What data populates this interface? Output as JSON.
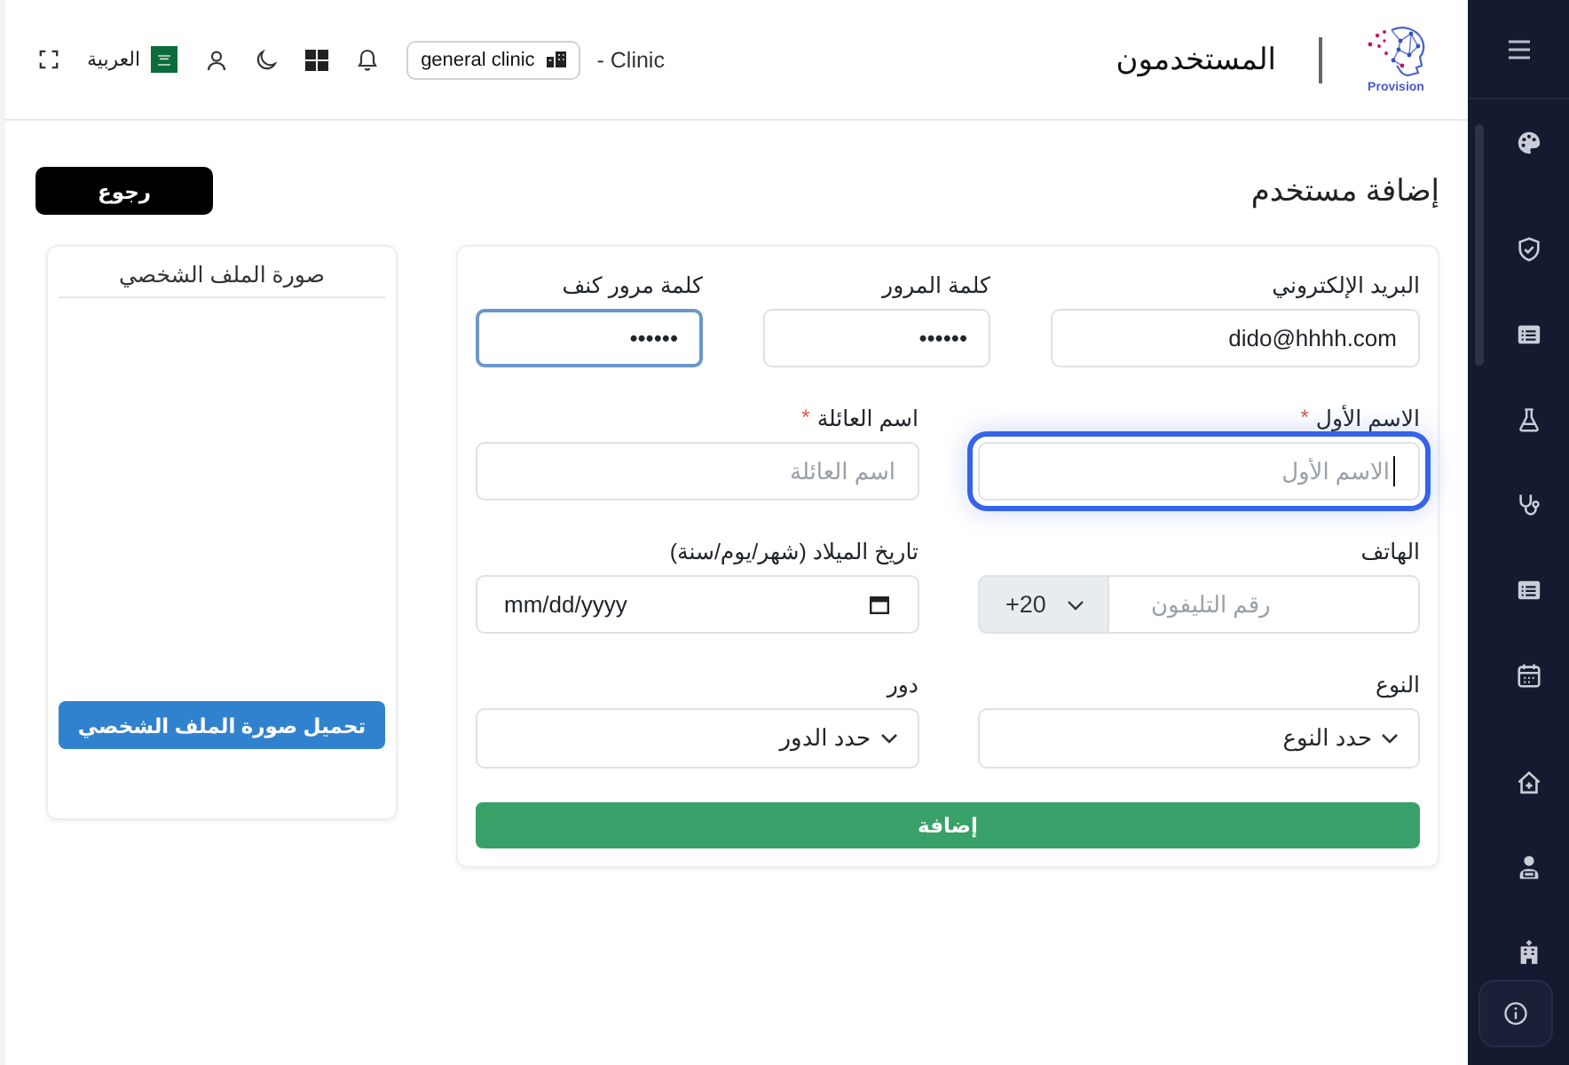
{
  "header": {
    "logo_text": "Provision",
    "title": "المستخدمون",
    "page_suffix": "- Clinic",
    "clinic_selector": {
      "label": "general clinic"
    },
    "language": {
      "label": "العربية"
    }
  },
  "page": {
    "title": "إضافة مستخدم",
    "back_button": "رجوع"
  },
  "form": {
    "rows": [
      {
        "fields": [
          {
            "kind": "text",
            "label": "البريد الإلكتروني",
            "value": "dido@hhhh.com",
            "focused": false,
            "highlighted": false
          },
          {
            "kind": "password",
            "label": "كلمة المرور",
            "value": "••••••",
            "focused": false,
            "highlighted": false
          },
          {
            "kind": "password",
            "label": "كلمة مرور كنف",
            "value": "••••••",
            "focused": false,
            "highlighted": true
          }
        ]
      },
      {
        "fields": [
          {
            "kind": "text",
            "label": "الاسم الأول",
            "required_mark": "*",
            "placeholder": "الاسم الأول",
            "focused": true,
            "highlighted": false
          },
          {
            "kind": "text",
            "label": "اسم العائلة",
            "required_mark": "*",
            "placeholder": "اسم العائلة",
            "focused": false,
            "highlighted": false
          }
        ]
      },
      {
        "fields": [
          {
            "kind": "phone",
            "label": "الهاتف",
            "country_code": "+20",
            "placeholder": "رقم التليفون",
            "focused": false,
            "highlighted": false
          },
          {
            "kind": "date",
            "label": "تاريخ الميلاد (شهر/يوم/سنة)",
            "placeholder": "mm/dd/yyyy",
            "focused": false,
            "highlighted": false
          }
        ]
      },
      {
        "fields": [
          {
            "kind": "select",
            "label": "النوع",
            "value": "حدد النوع",
            "focused": false,
            "highlighted": false
          },
          {
            "kind": "select",
            "label": "دور",
            "value": "حدد الدور",
            "focused": false,
            "highlighted": false
          }
        ]
      }
    ],
    "submit_button": "إضافة"
  },
  "profile_photo": {
    "title": "صورة الملف الشخصي",
    "upload_button": "تحميل صورة الملف الشخصي"
  }
}
